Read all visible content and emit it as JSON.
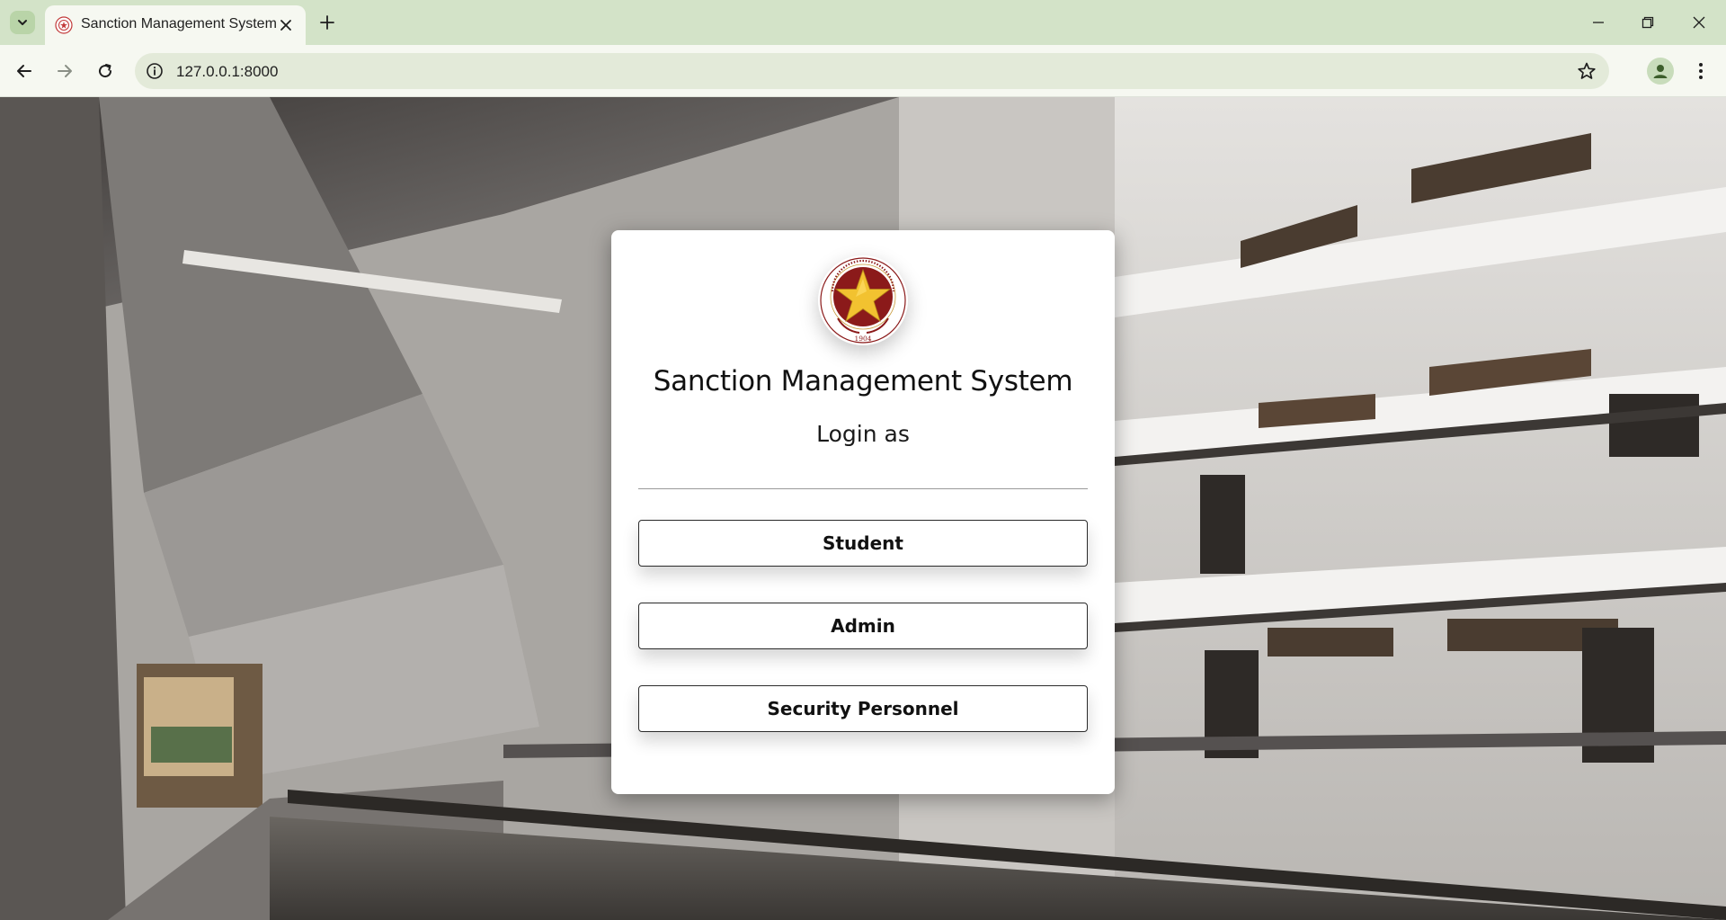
{
  "browser": {
    "tab": {
      "title": "Sanction Management System",
      "favicon": "pup-seal-icon"
    },
    "url": "127.0.0.1:8000",
    "colors": {
      "tabbar": "#d3e3c8",
      "toolbar": "#f6f8f1",
      "omnibox": "#e3ead9"
    }
  },
  "page": {
    "background": "campus-building-photo",
    "card": {
      "logo": "pup-seal",
      "logo_year": "1904",
      "title": "Sanction Management System",
      "subtitle": "Login as",
      "buttons": [
        {
          "label": "Student"
        },
        {
          "label": "Admin"
        },
        {
          "label": "Security Personnel"
        }
      ]
    },
    "colors": {
      "seal_maroon": "#8b1a1a",
      "seal_gold": "#f2c230"
    }
  }
}
